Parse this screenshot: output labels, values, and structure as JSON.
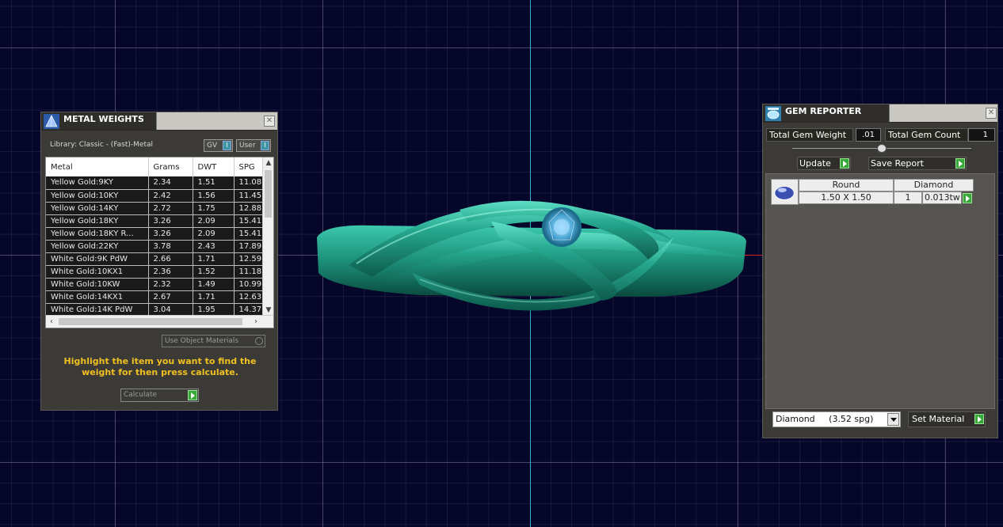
{
  "metal_weights": {
    "title": "METAL WEIGHTS",
    "library_label": "Library: Classic - (Fast)-Metal",
    "gv_label": "GV",
    "user_label": "User",
    "columns": [
      "Metal",
      "Grams",
      "DWT",
      "SPG"
    ],
    "rows": [
      [
        "Yellow Gold:9KY",
        "2.34",
        "1.51",
        "11.08"
      ],
      [
        "Yellow Gold:10KY",
        "2.42",
        "1.56",
        "11.45"
      ],
      [
        "Yellow Gold:14KY",
        "2.72",
        "1.75",
        "12.88"
      ],
      [
        "Yellow Gold:18KY",
        "3.26",
        "2.09",
        "15.41"
      ],
      [
        "Yellow Gold:18KY R...",
        "3.26",
        "2.09",
        "15.41"
      ],
      [
        "Yellow Gold:22KY",
        "3.78",
        "2.43",
        "17.89"
      ],
      [
        "White Gold:9K PdW",
        "2.66",
        "1.71",
        "12.59"
      ],
      [
        "White Gold:10KX1",
        "2.36",
        "1.52",
        "11.18"
      ],
      [
        "White Gold:10KW",
        "2.32",
        "1.49",
        "10.99"
      ],
      [
        "White Gold:14KX1",
        "2.67",
        "1.71",
        "12.63"
      ],
      [
        "White Gold:14K PdW",
        "3.04",
        "1.95",
        "14.37"
      ]
    ],
    "use_object_materials": "Use Object Materials",
    "hint": "Highlight the item you want to find the weight for then press calculate.",
    "calculate_label": "Calculate"
  },
  "gem_reporter": {
    "title": "GEM REPORTER",
    "total_weight_label": "Total Gem Weight",
    "total_weight_value": ".01",
    "total_count_label": "Total Gem Count",
    "total_count_value": "1",
    "update_label": "Update",
    "save_report_label": "Save Report",
    "gem": {
      "shape": "Round",
      "material": "Diamond",
      "size": "1.50 X 1.50",
      "count": "1",
      "weight": "0.013tw"
    },
    "material_select": "Diamond     (3.52 spg)",
    "set_material_label": "Set Material"
  },
  "colors": {
    "viewport_bg": "#06062a",
    "ring_teal": "#1f9d85",
    "hint_yellow": "#f0c020",
    "go_green": "#38a838"
  }
}
